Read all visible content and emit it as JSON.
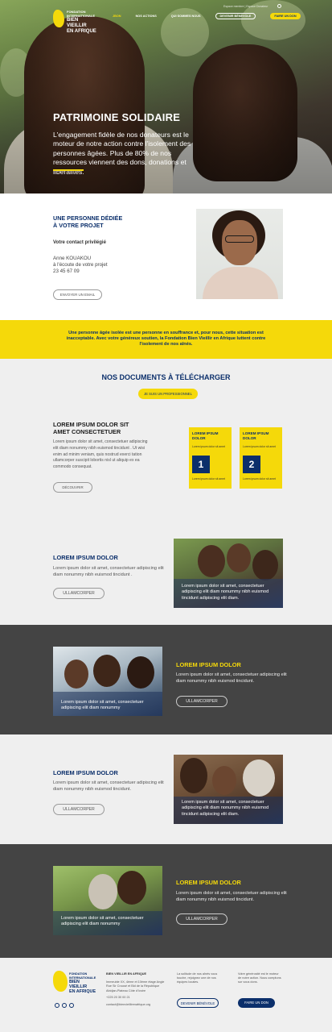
{
  "header": {
    "logo_line1": "Fondation",
    "logo_line2": "Internationale",
    "logo_line3": "Bien Vieillir",
    "logo_line4": "en Afrique",
    "utility_text": "Espace membre | Espace Donateur",
    "nav": [
      {
        "label": "Jbon"
      },
      {
        "label": "Nos actions"
      },
      {
        "label": "Qui sommes nous"
      },
      {
        "label": "Devenir bénévole"
      },
      {
        "label": "Faire un don"
      }
    ]
  },
  "hero": {
    "title": "PATRIMOINE SOLIDAIRE",
    "text": "L'engagement fidèle de nos donateurs est le moteur de notre action contre l'isolement des personnes âgées. Plus de 80% de nos ressources viennent des dons, donations et libéralités."
  },
  "contact": {
    "title_line1": "UNE PERSONNE DÉDIÉE",
    "title_line2": "À VOTRE PROJET",
    "subtitle": "Votre contact privilégié",
    "name": "Anne KOUAKOU",
    "role": "à l'écoute de votre projet",
    "phone": "23 45 67 09",
    "button": "Envoyer un email"
  },
  "banner": {
    "text": "Une personne âgée isolée est une personne en souffrance et, pour nous, cette situation est inacceptable. Avec votre généreux soutien, la Fondation Bien Vieillir en Afrique luttent contre l'isolement de nos aînés."
  },
  "documents": {
    "title": "NOS DOCUMENTS À TÉLÉCHARGER",
    "pro_button": "Je suis un professionnel",
    "heading_line1": "LOREM IPSUM DOLOR SIT",
    "heading_line2": "AMET CONSECTETUER",
    "body": "Lorem ipsum dolor sit amet, consectetuer adipiscing elit diam nonummy nibh euismod tincidunt . Ut wisi enim ad minim veniam, quis nostrud exerci tation ullamcorper suscipit lobortis nisl ut aliquip ex ea commodo consequat.",
    "discover_button": "Découvrir",
    "cards": [
      {
        "title": "Lorem ipsum dolor",
        "sub": "Lorem ipsum dolor sit amet",
        "number": "1",
        "foot": "Lorem ipsum dolor sit amet"
      },
      {
        "title": "Lorem ipsum dolor",
        "sub": "Lorem ipsum dolor sit amet",
        "number": "2",
        "foot": "Lorem ipsum dolor sit amet"
      }
    ]
  },
  "sections": [
    {
      "heading": "LOREM IPSUM DOLOR",
      "text": "Lorem ipsum dolor sit amet, consectetuer adipiscing elit diam nonummy nibh euismod tincidunt .",
      "button": "Ullamcorper",
      "caption": "Lorem ipsum dolor sit amet, consectetuer adipiscing elit diam nonummy nibh euismod tincidunt adipiscing elit diam."
    },
    {
      "heading": "LOREM IPSUM DOLOR",
      "text": "Lorem ipsum dolor sit amet, consectetuer adipiscing elit diam nonummy nibh euismod tincidunt.",
      "button": "Ullamcorper",
      "caption": "Lorem ipsum dolor sit amet, consectetuer adipiscing elit diam nonummy"
    },
    {
      "heading": "LOREM IPSUM DOLOR",
      "text": "Lorem ipsum dolor sit amet, consectetuer adipiscing elit diam nonummy nibh euismod tincidunt.",
      "button": "Ullamcorper",
      "caption": "Lorem ipsum dolor sit amet, consectetuer adipiscing elit diam nonummy nibh euismod tincidunt adipiscing elit diam."
    },
    {
      "heading": "LOREM IPSUM DOLOR",
      "text": "Lorem ipsum dolor sit amet, consectetuer adipiscing elit diam nonummy nibh euismod tincidunt.",
      "button": "Ullamcorper",
      "caption": "Lorem ipsum dolor sit amet, consectetuer adipiscing elit diam nonummy"
    }
  ],
  "footer": {
    "org_title": "BIEN VIEILLIR EN AFRIQUE",
    "address": "Immeuble XX, 4ème et 10ème étage Angle Rue Sir Crousé et Bld de la République Abidjan-Plateau Côte d'Ivoire",
    "phone": "+225 20 30 00 21",
    "email": "contact@bienvieillirenafrique.org",
    "volunteer_text": "La solitude de nos aînés vous touche, rejoignez une de nos équipes locales.",
    "volunteer_button": "Devenir bénévole",
    "donate_text": "Votre générosité est le moteur de notre action. Nous comptons sur vous dons.",
    "donate_button": "Faire un don"
  },
  "colors": {
    "navy": "#0b2f6b",
    "yellow": "#f5d90a",
    "dark_gray": "#444444",
    "light_gray": "#efefef"
  }
}
